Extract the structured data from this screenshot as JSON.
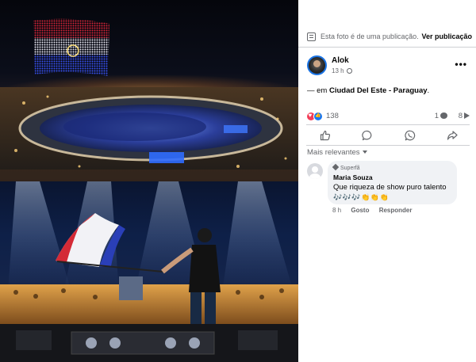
{
  "publication_bar": {
    "text": "Esta foto é de uma publicação.",
    "link": "Ver publicação"
  },
  "post": {
    "author": "Alok",
    "time": "13 h",
    "text_prefix": "— em ",
    "location": "Ciudad Del Este - Paraguay",
    "text_suffix": "."
  },
  "stats": {
    "reactions": "138",
    "comments": "1",
    "shares": "8"
  },
  "actions": {
    "like_icon": "thumbs-up-icon",
    "comment_icon": "comment-icon",
    "whatsapp_icon": "whatsapp-icon",
    "share_icon": "share-icon"
  },
  "comments_filter": {
    "label": "Mais relevantes"
  },
  "comment": {
    "badge": "Superfã",
    "name": "Maria Souza",
    "text": "Que riqueza de show puro talento",
    "emoji": "🎶🎶🎶👏👏👏",
    "time": "8 h",
    "like": "Gosto",
    "reply": "Responder"
  },
  "colors": {
    "accent": "#1877f2",
    "love": "#f33e58",
    "secondary_text": "#65676b",
    "bubble": "#f0f2f5"
  }
}
